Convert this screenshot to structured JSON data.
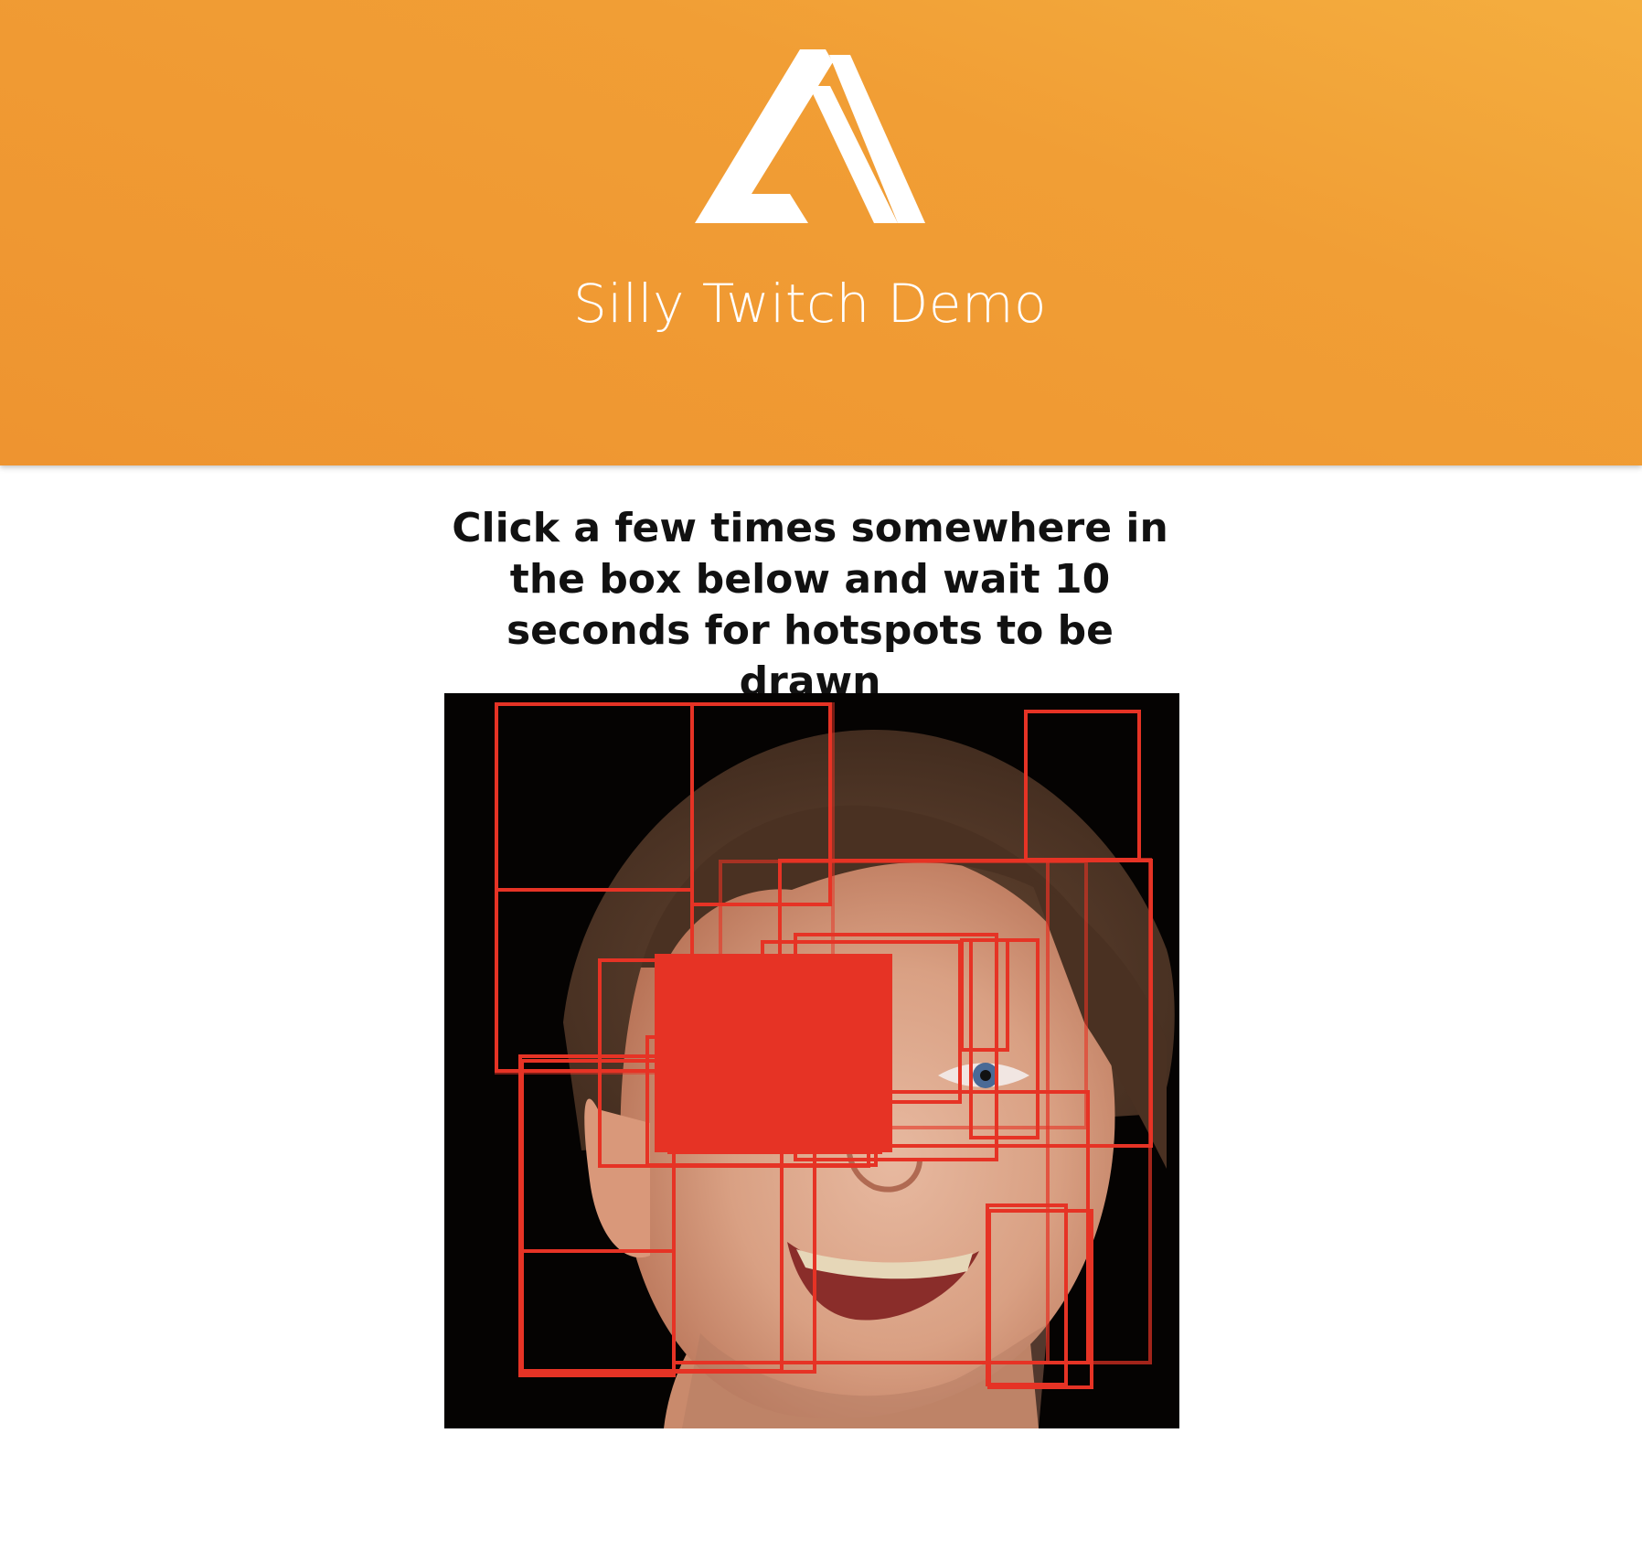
{
  "header": {
    "logo_icon": "amplify-logo-icon",
    "title": "Silly Twitch Demo",
    "background_color": "#f19e35"
  },
  "main": {
    "instructions": "Click a few times somewhere in the box below and wait 10 seconds for hotspots to be drawn"
  },
  "hotspots": {
    "stroke_color": "#e63325",
    "fill_color": "#e63325",
    "count_outlined": 21,
    "count_filled": 1
  }
}
